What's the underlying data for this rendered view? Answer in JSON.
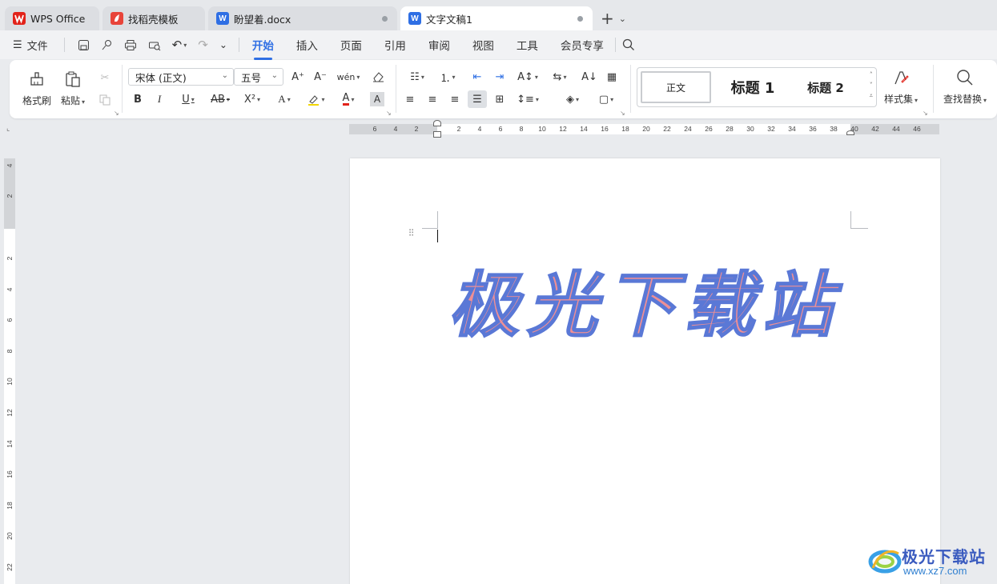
{
  "tabs": [
    {
      "label": "WPS Office",
      "icon": "wps-logo-icon",
      "color": "#e2231a"
    },
    {
      "label": "找稻壳模板",
      "icon": "docer-icon",
      "color": "#e8443a"
    },
    {
      "label": "盼望着.docx",
      "icon": "word-doc-icon",
      "color": "#2f6fe4"
    },
    {
      "label": "文字文稿1",
      "icon": "word-doc-icon",
      "color": "#2f6fe4"
    }
  ],
  "menu": {
    "file": "文件",
    "tabs": [
      "开始",
      "插入",
      "页面",
      "引用",
      "审阅",
      "视图",
      "工具",
      "会员专享"
    ],
    "active_tab": "开始"
  },
  "ribbon": {
    "format_painter": "格式刷",
    "paste": "粘贴",
    "font_name": "宋体 (正文)",
    "font_size": "五号",
    "styles": [
      "正文",
      "标题 1",
      "标题 2"
    ],
    "style_set": "样式集",
    "find_replace": "查找替换"
  },
  "ruler": {
    "h_left": [
      "6",
      "4",
      "2"
    ],
    "h_right": [
      "2",
      "4",
      "6",
      "8",
      "10",
      "12",
      "14",
      "16",
      "18",
      "20",
      "22",
      "24",
      "26",
      "28",
      "30",
      "32",
      "34",
      "36",
      "38",
      "40",
      "42",
      "44",
      "46"
    ],
    "v_top": [
      "4",
      "2"
    ],
    "v_main": [
      "2",
      "4",
      "6",
      "8",
      "10",
      "12",
      "14",
      "16",
      "18",
      "20",
      "22"
    ]
  },
  "document": {
    "word_art": "极光下载站",
    "word_art_fill": "#ee8f95",
    "word_art_stroke": "#5a78d6"
  },
  "watermark": {
    "title": "极光下载站",
    "url": "www.xz7.com"
  },
  "colors": {
    "accent": "#2f6fe4"
  }
}
